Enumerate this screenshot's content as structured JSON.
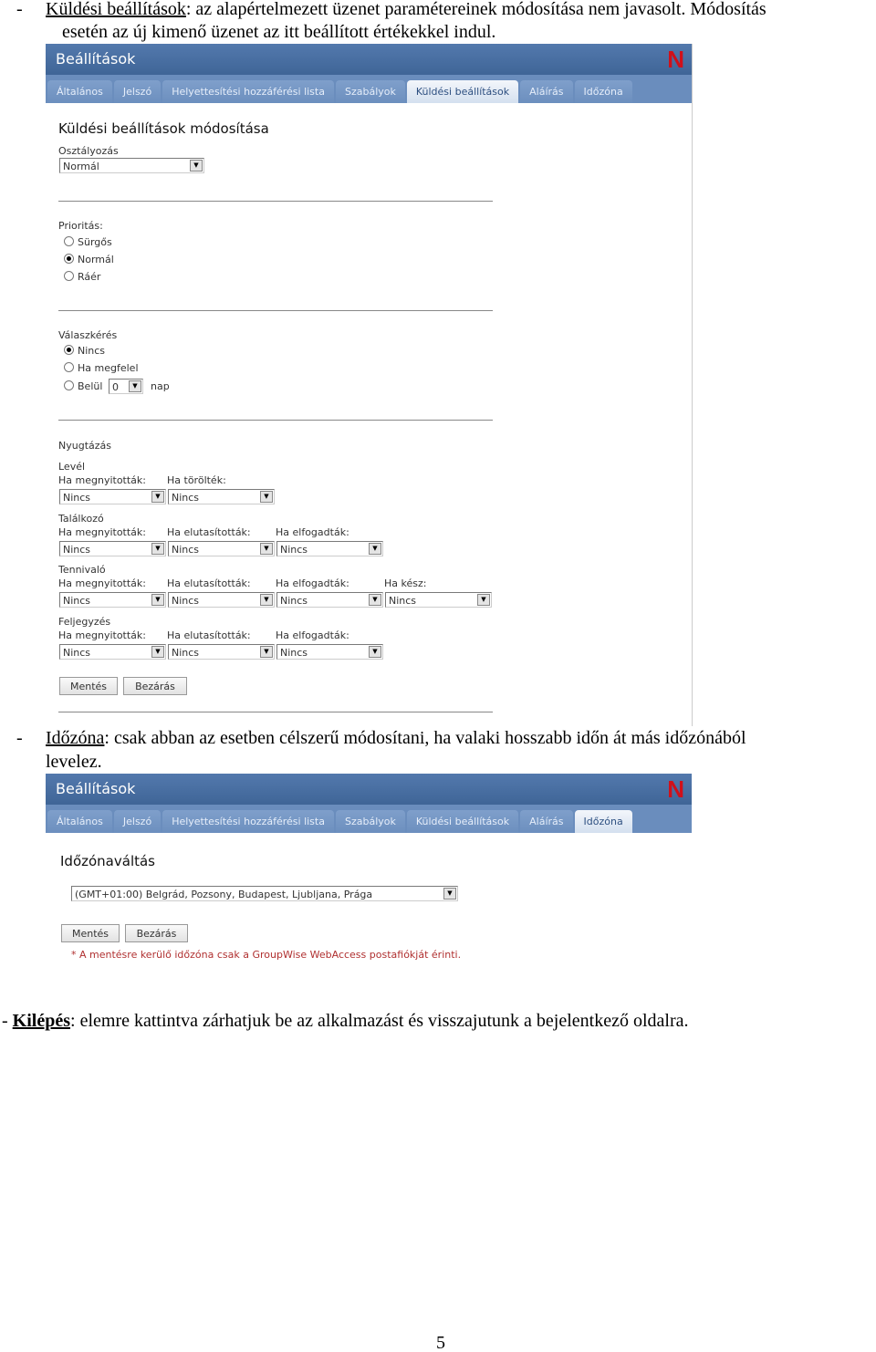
{
  "paragraphs": {
    "p1": {
      "bullet": "-",
      "term": "Küldési beállítások",
      "text_line1": ": az alapértelmezett üzenet paramétereinek módosítása nem javasolt. Módosítás",
      "text_line2": "esetén az új kimenő üzenet az itt beállított értékekkel indul."
    },
    "p2": {
      "bullet": "-",
      "term": "Időzóna",
      "text_line1": ": csak abban az esetben célszerű módosítani, ha valaki hosszabb időn át más időzónából",
      "text_line2": "levelez."
    },
    "p3": {
      "bullet": "-",
      "term": "Kilépés",
      "text": ": elemre kattintva zárhatjuk be az alkalmazást és visszajutunk a bejelentkező oldalra."
    }
  },
  "page_number": "5",
  "app": {
    "title": "Beállítások",
    "logo": "N",
    "tabs": [
      "Általános",
      "Jelszó",
      "Helyettesítési hozzáférési lista",
      "Szabályok",
      "Küldési beállítások",
      "Aláírás",
      "Időzóna"
    ],
    "colors": {
      "header": "#4a6fa5",
      "tabbar": "#6a8dbd",
      "logo": "#d0101a",
      "note": "#b03030"
    }
  },
  "send_settings": {
    "active_tab": "Küldési beállítások",
    "heading": "Küldési beállítások módosítása",
    "classification_label": "Osztályozás",
    "classification_value": "Normál",
    "priority_label": "Prioritás:",
    "priority_options": [
      "Sürgős",
      "Normál",
      "Ráér"
    ],
    "priority_selected": "Normál",
    "reply_label": "Válaszkérés",
    "reply_options": [
      "Nincs",
      "Ha megfelel",
      "Belül"
    ],
    "reply_selected": "Nincs",
    "reply_days_value": "0",
    "reply_days_unit": "nap",
    "ack_label": "Nyugtázás",
    "groups": [
      {
        "name": "Levél",
        "fields": [
          {
            "label": "Ha megnyitották:",
            "value": "Nincs"
          },
          {
            "label": "Ha törölték:",
            "value": "Nincs"
          }
        ]
      },
      {
        "name": "Találkozó",
        "fields": [
          {
            "label": "Ha megnyitották:",
            "value": "Nincs"
          },
          {
            "label": "Ha elutasították:",
            "value": "Nincs"
          },
          {
            "label": "Ha elfogadták:",
            "value": "Nincs"
          }
        ]
      },
      {
        "name": "Tennivaló",
        "fields": [
          {
            "label": "Ha megnyitották:",
            "value": "Nincs"
          },
          {
            "label": "Ha elutasították:",
            "value": "Nincs"
          },
          {
            "label": "Ha elfogadták:",
            "value": "Nincs"
          },
          {
            "label": "Ha kész:",
            "value": "Nincs"
          }
        ]
      },
      {
        "name": "Feljegyzés",
        "fields": [
          {
            "label": "Ha megnyitották:",
            "value": "Nincs"
          },
          {
            "label": "Ha elutasították:",
            "value": "Nincs"
          },
          {
            "label": "Ha elfogadták:",
            "value": "Nincs"
          }
        ]
      }
    ],
    "save_label": "Mentés",
    "close_label": "Bezárás"
  },
  "timezone": {
    "active_tab": "Időzóna",
    "heading": "Időzónaváltás",
    "value": "(GMT+01:00) Belgrád, Pozsony, Budapest, Ljubljana, Prága",
    "save_label": "Mentés",
    "close_label": "Bezárás",
    "note": "* A mentésre kerülő időzóna csak a GroupWise WebAccess postafiókját érinti."
  }
}
